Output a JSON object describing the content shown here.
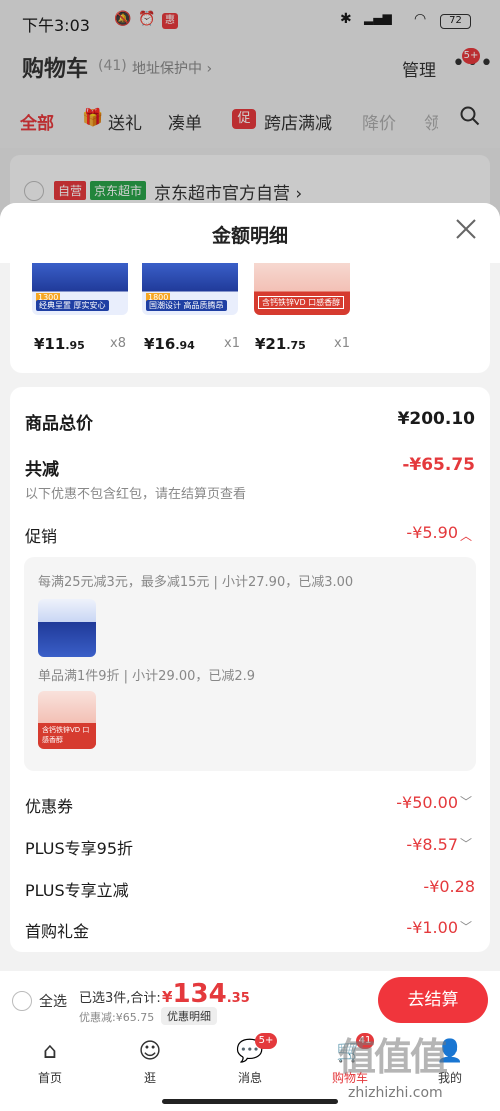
{
  "status_bar": {
    "time": "下午3:03",
    "battery": "72",
    "app_badge": "惠"
  },
  "header": {
    "title": "购物车",
    "count": "(41)",
    "address": "地址保护中 ›",
    "manage": "管理",
    "more_badge": "5+"
  },
  "tabs": [
    {
      "label": "全部"
    },
    {
      "label": "送礼"
    },
    {
      "label": "凑单"
    },
    {
      "label": "跨店满减"
    },
    {
      "label": "降价"
    },
    {
      "label": "领"
    }
  ],
  "tabs_extra": {
    "promo_icon": "促"
  },
  "store": {
    "self_tag": "自营",
    "market_tag": "京东超市",
    "name": "京东超市官方自营 ›"
  },
  "sheet": {
    "title": "金额明细",
    "products": [
      {
        "price_int": "¥11",
        "price_dec": ".95",
        "qty": "x8",
        "thumb_tag": "经典呈置 厚实安心",
        "thumb_num": "1300"
      },
      {
        "price_int": "¥16",
        "price_dec": ".94",
        "qty": "x1",
        "thumb_tag": "国潮设计 高品质腾昂",
        "thumb_num": "1800"
      },
      {
        "price_int": "¥21",
        "price_dec": ".75",
        "qty": "x1",
        "thumb_tag": "含钙铁锌VD 口感香醇"
      }
    ],
    "total_label": "商品总价",
    "total_value": "¥200.10",
    "reduce_label": "共减",
    "reduce_value": "-¥65.75",
    "reduce_hint": "以下优惠不包含红包，请在结算页查看",
    "promo_label": "促销",
    "promo_value": "-¥5.90",
    "promo_rule1": "每满25元减3元，最多减15元 | 小计27.90，已减3.00",
    "promo_rule2": "单品满1件9折 | 小计29.00，已减2.9",
    "coupon_label": "优惠券",
    "coupon_value": "-¥50.00",
    "plus95_label": "PLUS专享95折",
    "plus95_value": "-¥8.57",
    "plusinst_label": "PLUS专享立减",
    "plusinst_value": "-¥0.28",
    "firstbuy_label": "首购礼金",
    "firstbuy_value": "-¥1.00"
  },
  "checkout": {
    "select_all": "全选",
    "selected": "已选3件,合计:",
    "yen": "¥",
    "amount_int": "134",
    "amount_dec": ".35",
    "discount": "优惠减:¥65.75",
    "detail_btn": "优惠明细",
    "go_button": "去结算"
  },
  "nav": [
    {
      "label": "首页",
      "icon": "home-icon"
    },
    {
      "label": "逛",
      "icon": "discover-icon"
    },
    {
      "label": "消息",
      "icon": "message-icon",
      "badge": "5+"
    },
    {
      "label": "购物车",
      "icon": "cart-icon",
      "badge": "41"
    },
    {
      "label": "我的",
      "icon": "profile-icon"
    }
  ],
  "watermark": {
    "logo": "值值值",
    "url": "zhizhizhi.com"
  },
  "colors": {
    "accent": "#e4393c",
    "market_green": "#2aa34a",
    "checkout_red": "#f0353c"
  }
}
